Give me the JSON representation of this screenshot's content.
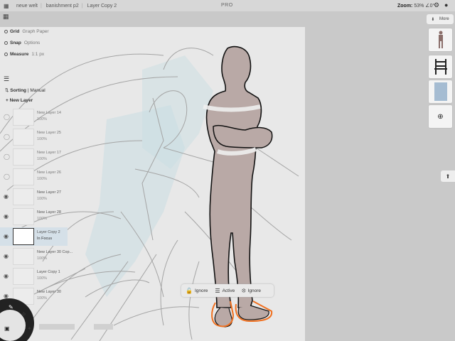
{
  "topbar": {
    "app_icon": "apps-grid-icon",
    "breadcrumbs": [
      "neue welt",
      "banishment p2",
      "Layer Copy 2"
    ],
    "pro_label": "PRO",
    "zoom_label": "Zoom:",
    "zoom_value": "53% ∠0°",
    "icons": [
      "gear-icon",
      "person-icon"
    ]
  },
  "left_panel": {
    "grid": {
      "label": "Grid",
      "sub": "Graph Paper"
    },
    "snap": {
      "label": "Snap",
      "sub": "Options"
    },
    "measure": {
      "label": "Measure",
      "sub": "1:1 px"
    },
    "sorting": {
      "label": "Sorting",
      "sub": "Manual"
    },
    "new_layer": "New Layer",
    "layers": [
      {
        "name": "New Layer 14",
        "opacity": "100%",
        "visible": false,
        "active": false
      },
      {
        "name": "New Layer 25",
        "opacity": "100%",
        "visible": false,
        "active": false
      },
      {
        "name": "New Layer 17",
        "opacity": "100%",
        "visible": false,
        "active": false
      },
      {
        "name": "New Layer 26",
        "opacity": "100%",
        "visible": false,
        "active": false
      },
      {
        "name": "New Layer 27",
        "opacity": "100%",
        "visible": true,
        "active": false
      },
      {
        "name": "New Layer 28",
        "opacity": "100%",
        "visible": true,
        "active": false
      },
      {
        "name": "Layer Copy 2",
        "opacity": "In Focus",
        "visible": true,
        "active": true
      },
      {
        "name": "New Layer 30 Cop...",
        "opacity": "100%",
        "visible": true,
        "active": false
      },
      {
        "name": "Layer Copy 1",
        "opacity": "100%",
        "visible": true,
        "active": false
      },
      {
        "name": "New Layer 30",
        "opacity": "100%",
        "visible": true,
        "active": false
      }
    ]
  },
  "right_panel": {
    "more_label": "More",
    "add_icon": "plus-circle-icon",
    "share_icon": "share-icon"
  },
  "selection_bar": {
    "lock": "Ignore",
    "mode": "Active",
    "transform": "Ignore"
  },
  "colors": {
    "figure_fill": "#b9a9a6",
    "selection_outline": "#f07020",
    "sketch_blue": "#c3dce2"
  }
}
